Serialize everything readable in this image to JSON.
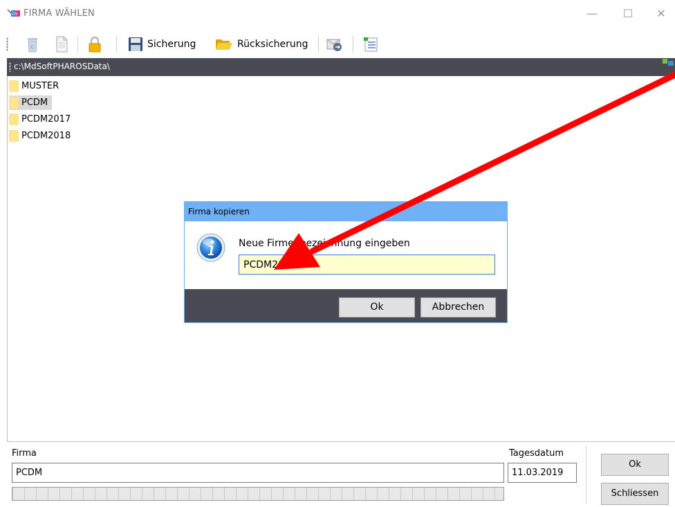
{
  "window": {
    "title": "FIRMA WÄHLEN",
    "minimize": "—",
    "maximize": "☐",
    "close": "✕"
  },
  "toolbar": {
    "backup_label": "Sicherung",
    "restore_label": "Rücksicherung"
  },
  "path": "c:\\MdSoftPHAROSData\\",
  "folders": [
    {
      "label": "MUSTER",
      "selected": false
    },
    {
      "label": "PCDM",
      "selected": true
    },
    {
      "label": "PCDM2017",
      "selected": false
    },
    {
      "label": "PCDM2018",
      "selected": false
    }
  ],
  "dialog": {
    "title": "Firma kopieren",
    "prompt": "Neue Firmenbezeichnung eingeben",
    "value": "PCDM2019",
    "ok_label": "Ok",
    "cancel_label": "Abbrechen"
  },
  "bottom": {
    "firma_label": "Firma",
    "firma_value": "PCDM",
    "date_label": "Tagesdatum",
    "date_value": "11.03.2019",
    "ok_label": "Ok",
    "close_label": "Schliessen"
  },
  "colors": {
    "dark_bar": "#4a4a55",
    "dialog_title": "#70b0f4",
    "folder": "#fde58e",
    "input_bg": "#ffffd0",
    "arrow": "#ff0000"
  }
}
